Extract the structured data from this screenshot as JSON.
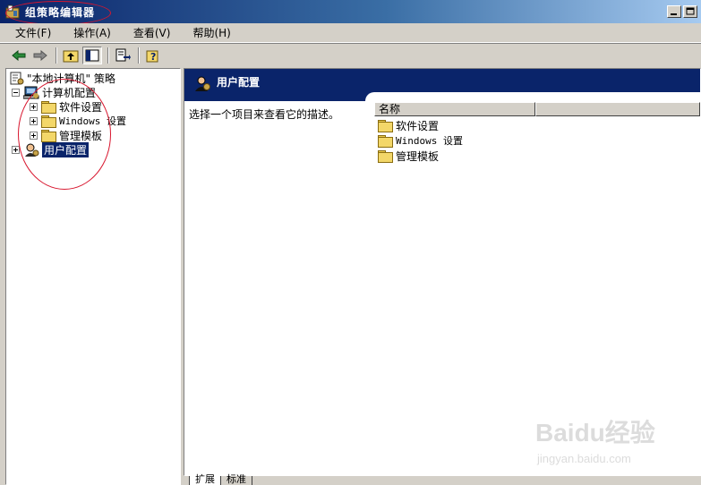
{
  "window": {
    "title": "组策略编辑器"
  },
  "menu": [
    "文件(F)",
    "操作(A)",
    "查看(V)",
    "帮助(H)"
  ],
  "toolbar": {
    "buttons": [
      "back-icon",
      "forward-icon",
      "up-folder-icon",
      "show-hide-tree-icon",
      "export-list-icon",
      "help-icon"
    ]
  },
  "tree": {
    "root": "\"本地计算机\" 策略",
    "computer_config": "计算机配置",
    "software_settings": "软件设置",
    "windows_settings": "Windows 设置",
    "admin_templates": "管理模板",
    "user_config": "用户配置"
  },
  "details": {
    "header_title": "用户配置",
    "description": "选择一个项目来查看它的描述。",
    "column_name": "名称",
    "items": [
      "软件设置",
      "Windows 设置",
      "管理模板"
    ]
  },
  "bottom_tabs": [
    "扩展",
    "标准"
  ],
  "watermark": {
    "brand": "Baidu经验",
    "url": "jingyan.baidu.com"
  },
  "colors": {
    "titlebar": "#0a246a",
    "selection": "#0a246a",
    "annotation": "#d8162e",
    "folder": "#f3d769"
  }
}
